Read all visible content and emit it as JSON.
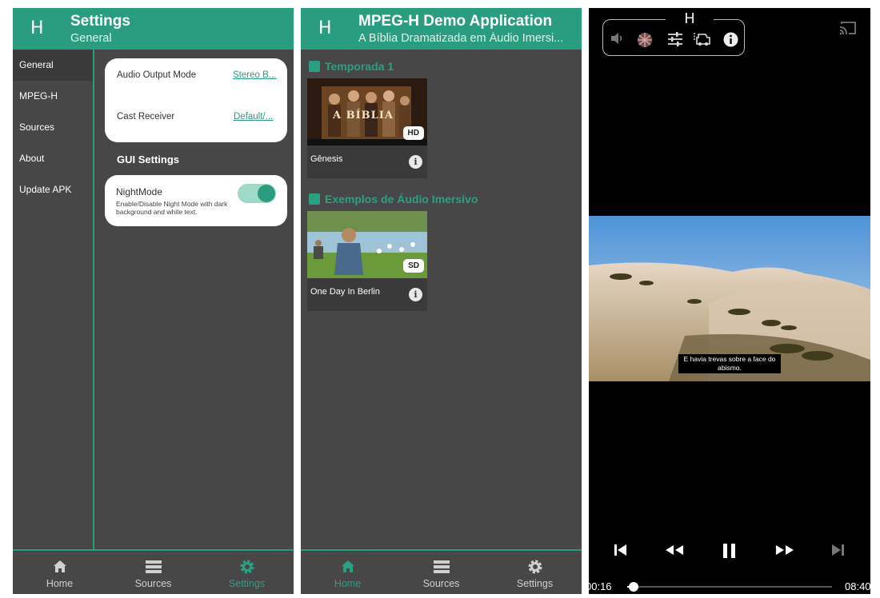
{
  "settings_screen": {
    "logo": "H",
    "title": "Settings",
    "subtitle": "General",
    "sidebar": [
      "General",
      "MPEG-H",
      "Sources",
      "About",
      "Update APK"
    ],
    "audio_output_label": "Audio Output Mode",
    "audio_output_value": "Stereo B...",
    "cast_receiver_label": "Cast Receiver",
    "cast_receiver_value": "Default/...",
    "gui_settings_heading": "GUI Settings",
    "nightmode_title": "NightMode",
    "nightmode_desc": "Enable/Disable Night Mode with dark background and white text.",
    "nightmode_on": true,
    "nav": {
      "home": "Home",
      "sources": "Sources",
      "settings": "Settings",
      "active": "settings"
    }
  },
  "library_screen": {
    "logo": "H",
    "title": "MPEG-H Demo Application",
    "subtitle": "A Bíblia Dramatizada em Áudio Imersi...",
    "categories": [
      {
        "name": "Temporada 1",
        "items": [
          {
            "title": "Gênesis",
            "badge": "HD",
            "thumb_text": "A BÍBLIA"
          }
        ]
      },
      {
        "name": "Exemplos de Áudio Imersivo",
        "items": [
          {
            "title": "One Day In Berlin",
            "badge": "SD"
          }
        ]
      }
    ],
    "nav": {
      "home": "Home",
      "sources": "Sources",
      "settings": "Settings",
      "active": "home"
    }
  },
  "player_screen": {
    "logo": "H",
    "icons": [
      "volume-icon",
      "language-globe-icon",
      "equalizer-icon",
      "presets-icon",
      "info-icon"
    ],
    "cast_icon": "cast-icon",
    "subtitle_text": "E havia trevas sobre a face do abismo.",
    "time_current": "00:16",
    "time_total": "08:40",
    "progress_fraction": 0.031,
    "playing": true
  },
  "colors": {
    "accent": "#2a9d80",
    "panel": "#474747",
    "player_bg": "#000000"
  }
}
